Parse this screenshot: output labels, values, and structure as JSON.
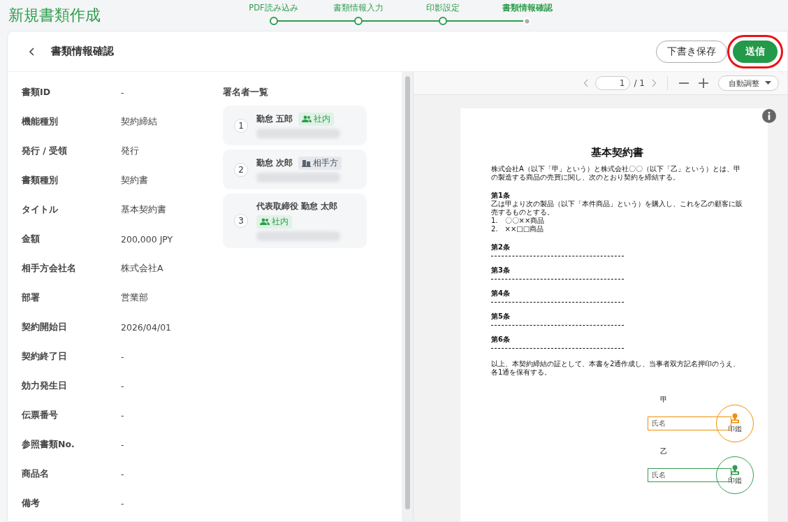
{
  "page_title": "新規書類作成",
  "steps": [
    {
      "label": "PDF読み込み",
      "completed": true,
      "selected": false
    },
    {
      "label": "書類情報入力",
      "completed": true,
      "selected": false
    },
    {
      "label": "印影設定",
      "completed": true,
      "selected": false
    },
    {
      "label": "書類情報確認",
      "completed": false,
      "selected": true
    }
  ],
  "header": {
    "title": "書類情報確認",
    "buttons": [
      {
        "label": "下書き保存",
        "kind": "outline",
        "highlighted": false
      },
      {
        "label": "送信",
        "kind": "primary",
        "highlighted": true
      }
    ]
  },
  "fields": [
    {
      "label": "書類ID",
      "value": "-"
    },
    {
      "label": "機能種別",
      "value": "契約締結"
    },
    {
      "label": "発行 / 受領",
      "value": "発行"
    },
    {
      "label": "書類種別",
      "value": "契約書"
    },
    {
      "label": "タイトル",
      "value": "基本契約書"
    },
    {
      "label": "金額",
      "value": "200,000 JPY"
    },
    {
      "label": "相手方会社名",
      "value": "株式会社A"
    },
    {
      "label": "部署",
      "value": "営業部"
    },
    {
      "label": "契約開始日",
      "value": "2026/04/01"
    },
    {
      "label": "契約終了日",
      "value": "-"
    },
    {
      "label": "効力発生日",
      "value": "-"
    },
    {
      "label": "伝票番号",
      "value": "-"
    },
    {
      "label": "参照書類No.",
      "value": "-"
    },
    {
      "label": "商品名",
      "value": "-"
    },
    {
      "label": "備考",
      "value": "-"
    }
  ],
  "signers": {
    "heading": "署名者一覧",
    "items": [
      {
        "number": "1",
        "name": "勤怠 五郎",
        "tag": {
          "kind": "internal",
          "label": "社内"
        }
      },
      {
        "number": "2",
        "name": "勤怠 次郎",
        "tag": {
          "kind": "external",
          "label": "相手方"
        }
      },
      {
        "number": "3",
        "name": "代表取締役 勤怠 太郎",
        "tag": {
          "kind": "internal",
          "label": "社内"
        }
      }
    ]
  },
  "viewer": {
    "page_input": "1",
    "page_total": "/ 1",
    "zoom": "自動調整",
    "document": {
      "title": "基本契約書",
      "intro": "株式会社A（以下「甲」という）と株式会社〇〇（以下「乙」という）とは、甲の製造する商品の売買に関し、次のとおり契約を締結する。",
      "articles": [
        {
          "heading": "第1条",
          "text": "乙は甲より次の製品（以下「本件商品」という）を購入し、これを乙の顧客に販売するものとする。",
          "items": [
            "1.　〇〇××商品",
            "2.　××□□商品"
          ]
        },
        {
          "heading": "第2条"
        },
        {
          "heading": "第3条"
        },
        {
          "heading": "第4条"
        },
        {
          "heading": "第5条"
        },
        {
          "heading": "第6条"
        }
      ],
      "closing": "以上、本契約締結の証として、本書を2通作成し、当事者双方記名押印のうえ、各1通を保有する。",
      "parties": [
        {
          "label": "甲",
          "field": "氏名",
          "stamp": "印鑑",
          "color": "#f0900a"
        },
        {
          "label": "乙",
          "field": "氏名",
          "stamp": "印鑑",
          "color": "#2e9e4f"
        }
      ]
    }
  }
}
